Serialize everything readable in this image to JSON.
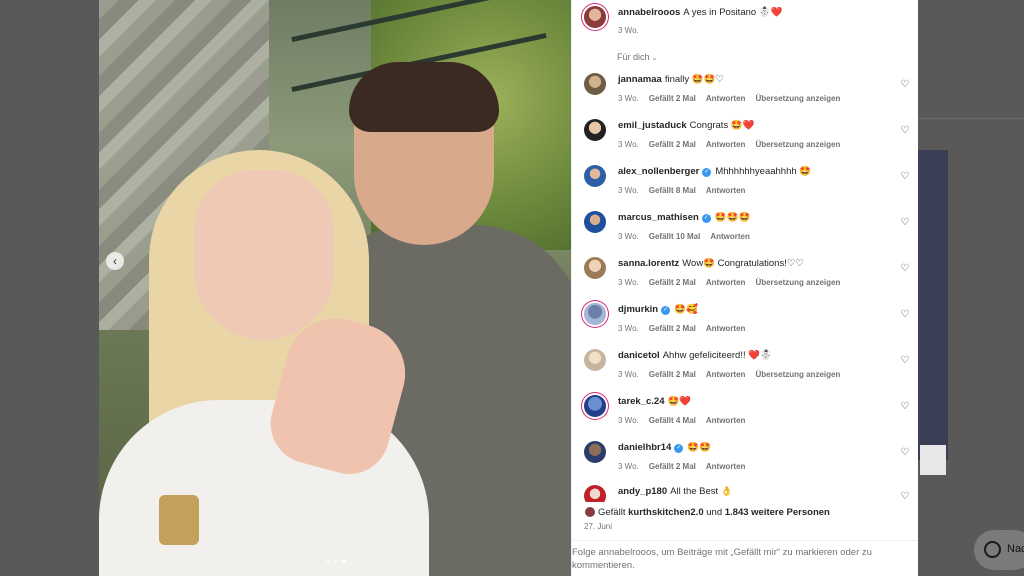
{
  "caption": {
    "username": "annabelrooos",
    "text": "A yes in Positano ☃️❤️",
    "time": "3 Wo."
  },
  "filter_label": "Für dich",
  "comments": [
    {
      "user": "jannamaa",
      "verified": false,
      "text": "finally 🤩🤩♡",
      "time": "3 Wo.",
      "likes": "Gefällt 2 Mal",
      "reply": "Antworten",
      "translate": "Übersetzung anzeigen"
    },
    {
      "user": "emil_justaduck",
      "verified": false,
      "text": "Congrats 🤩❤️",
      "time": "3 Wo.",
      "likes": "Gefällt 2 Mal",
      "reply": "Antworten",
      "translate": "Übersetzung anzeigen"
    },
    {
      "user": "alex_nollenberger",
      "verified": true,
      "text": "Mhhhhhhyeaahhhh 🤩",
      "time": "3 Wo.",
      "likes": "Gefällt 8 Mal",
      "reply": "Antworten",
      "translate": ""
    },
    {
      "user": "marcus_mathisen",
      "verified": true,
      "text": "🤩🤩🤩",
      "time": "3 Wo.",
      "likes": "Gefällt 10 Mal",
      "reply": "Antworten",
      "translate": ""
    },
    {
      "user": "sanna.lorentz",
      "verified": false,
      "text": "Wow🤩 Congratulations!♡♡",
      "time": "3 Wo.",
      "likes": "Gefällt 2 Mal",
      "reply": "Antworten",
      "translate": "Übersetzung anzeigen"
    },
    {
      "user": "djmurkin",
      "verified": true,
      "text": "🤩🥰",
      "time": "3 Wo.",
      "likes": "Gefällt 2 Mal",
      "reply": "Antworten",
      "translate": ""
    },
    {
      "user": "danicetol",
      "verified": false,
      "text": "Ahhw gefeliciteerd!! ❤️☃️",
      "time": "3 Wo.",
      "likes": "Gefällt 2 Mal",
      "reply": "Antworten",
      "translate": "Übersetzung anzeigen"
    },
    {
      "user": "tarek_c.24",
      "verified": false,
      "text": "🤩❤️",
      "time": "3 Wo.",
      "likes": "Gefällt 4 Mal",
      "reply": "Antworten",
      "translate": ""
    },
    {
      "user": "danielhbr14",
      "verified": true,
      "text": "🤩🤩",
      "time": "3 Wo.",
      "likes": "Gefällt 2 Mal",
      "reply": "Antworten",
      "translate": ""
    },
    {
      "user": "andy_p180",
      "verified": false,
      "text": "All the Best 👌",
      "time": "",
      "likes": "",
      "reply": "",
      "translate": ""
    }
  ],
  "likes": {
    "prefix": "Gefällt",
    "user": "kurthskitchen2.0",
    "middle": "und",
    "others": "1.843 weitere Personen",
    "date": "27. Juni"
  },
  "footer_text": "Folge annabelrooos, um Beiträge mit „Gefällt mir“ zu markieren oder zu kommentieren.",
  "background": {
    "bubble_label": "Nac"
  },
  "colors": {
    "verified": "#3897f0",
    "muted_text": "#737373",
    "primary_text": "#262626"
  }
}
